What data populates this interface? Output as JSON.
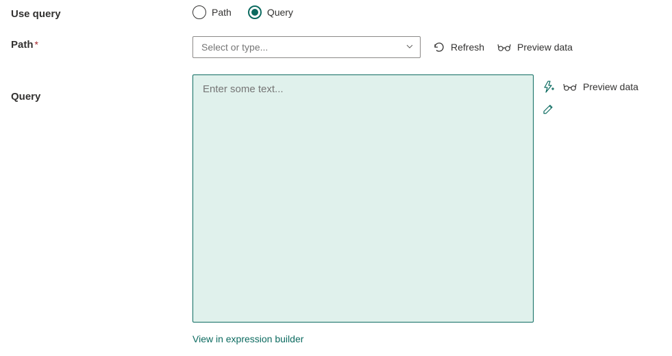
{
  "labels": {
    "use_query": "Use query",
    "path": "Path",
    "query": "Query"
  },
  "radio": {
    "path": "Path",
    "query": "Query"
  },
  "path_field": {
    "placeholder": "Select or type..."
  },
  "actions": {
    "refresh": "Refresh",
    "preview_data": "Preview data"
  },
  "query_field": {
    "placeholder": "Enter some text..."
  },
  "query_side": {
    "preview_data": "Preview data"
  },
  "links": {
    "expression_builder": "View in expression builder"
  }
}
